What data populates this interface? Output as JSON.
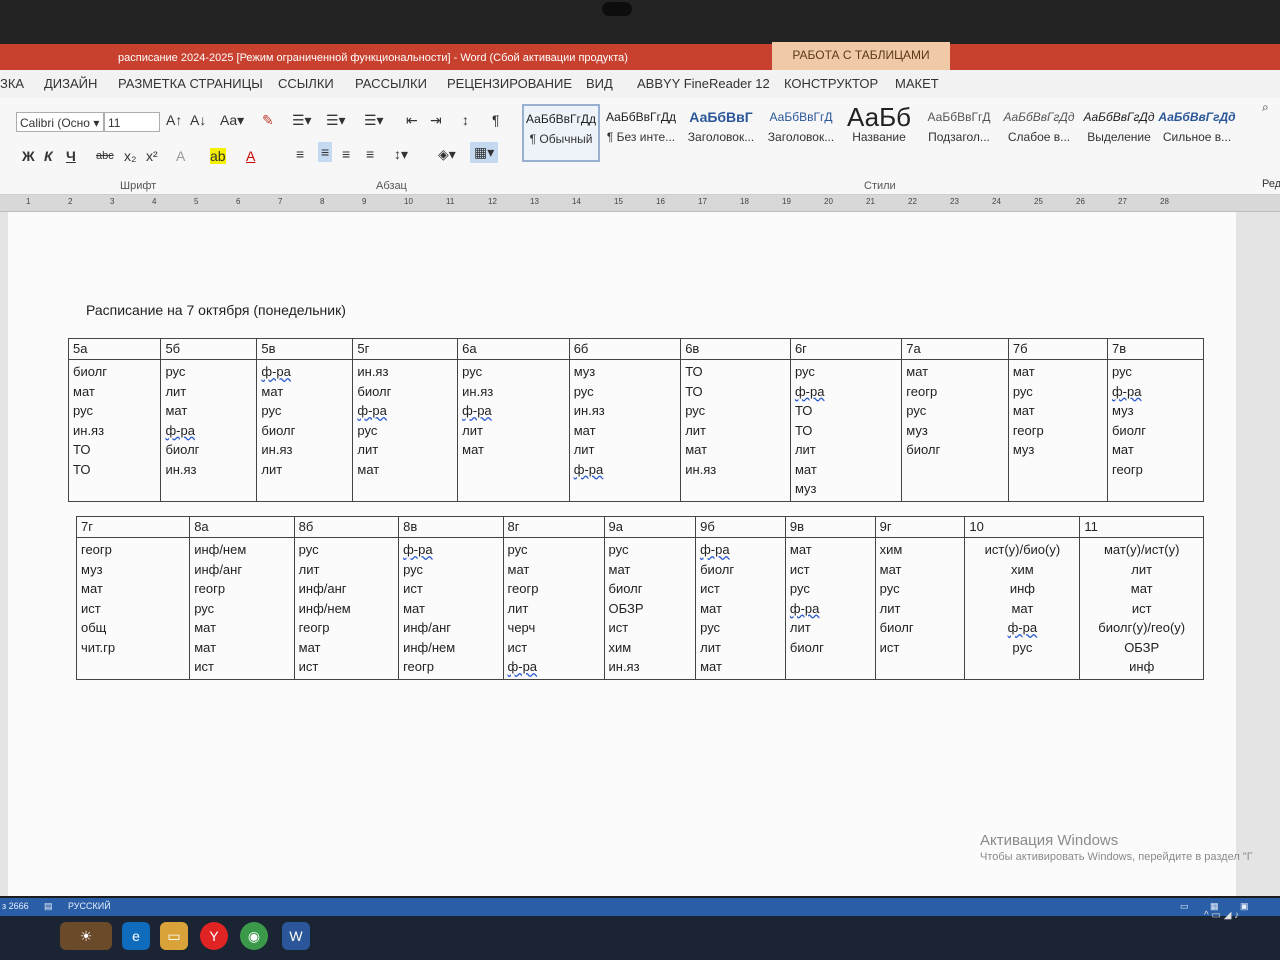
{
  "window": {
    "title": "расписание 2024-2025 [Режим ограниченной функциональности]  -  Word (Сбой активации продукта)",
    "context_tab": "РАБОТА С ТАБЛИЦАМИ"
  },
  "menu": [
    "ЗКА",
    "ДИЗАЙН",
    "РАЗМЕТКА СТРАНИЦЫ",
    "ССЫЛКИ",
    "РАССЫЛКИ",
    "РЕЦЕНЗИРОВАНИЕ",
    "ВИД",
    "ABBYY FineReader 12",
    "КОНСТРУКТОР",
    "МАКЕТ"
  ],
  "ribbon": {
    "font_name": "Calibri (Осно",
    "font_size": "11",
    "font_group": "Шрифт",
    "paragraph_group": "Абзац",
    "styles_group": "Стили",
    "styles": [
      {
        "preview": "АаБбВвГгДд",
        "name": "¶ Обычный"
      },
      {
        "preview": "АаБбВвГгДд",
        "name": "¶ Без инте..."
      },
      {
        "preview": "АаБбВвГ",
        "name": "Заголовок..."
      },
      {
        "preview": "АаБбВвГгД",
        "name": "Заголовок..."
      },
      {
        "preview": "АаБб",
        "name": "Название"
      },
      {
        "preview": "АаБбВвГгД",
        "name": "Подзагол..."
      },
      {
        "preview": "АаБбВвГгДд",
        "name": "Слабое в..."
      },
      {
        "preview": "АаБбВвГгДд",
        "name": "Выделение"
      },
      {
        "preview": "АаБбВвГгДд",
        "name": "Сильное в..."
      }
    ],
    "right_label": "Ред"
  },
  "ruler": [
    "1",
    "2",
    "3",
    "4",
    "5",
    "6",
    "7",
    "8",
    "9",
    "10",
    "11",
    "12",
    "13",
    "14",
    "15",
    "16",
    "17",
    "18",
    "19",
    "20",
    "21",
    "22",
    "23",
    "24",
    "25",
    "26",
    "27",
    "28"
  ],
  "document": {
    "title": "Расписание на 7 октября (понедельник)",
    "table1": {
      "headers": [
        "5а",
        "5б",
        "5в",
        "5г",
        "6а",
        "6б",
        "6в",
        "6г",
        "7а",
        "7б",
        "7в"
      ],
      "columns": [
        [
          "биолг",
          "мат",
          "рус",
          "ин.яз",
          "ТО",
          "ТО"
        ],
        [
          "рус",
          "лит",
          "мат",
          "ф-ра",
          "биолг",
          "ин.яз"
        ],
        [
          "ф-ра",
          "мат",
          "рус",
          "биолг",
          "ин.яз",
          "лит"
        ],
        [
          "ин.яз",
          "биолг",
          "ф-ра",
          "рус",
          "лит",
          "мат"
        ],
        [
          "рус",
          "ин.яз",
          "ф-ра",
          "лит",
          "мат"
        ],
        [
          "муз",
          "рус",
          "ин.яз",
          "мат",
          "лит",
          "ф-ра"
        ],
        [
          "ТО",
          "ТО",
          "рус",
          "лит",
          "мат",
          "ин.яз"
        ],
        [
          "рус",
          "ф-ра",
          "ТО",
          "ТО",
          "лит",
          "мат",
          "муз"
        ],
        [
          "мат",
          "геогр",
          "рус",
          "муз",
          "биолг"
        ],
        [
          "мат",
          "рус",
          "мат",
          "геогр",
          "муз"
        ],
        [
          "рус",
          "ф-ра",
          "муз",
          "биолг",
          "мат",
          "геогр"
        ]
      ]
    },
    "table2": {
      "headers": [
        "7г",
        "8а",
        "8б",
        "8в",
        "8г",
        "9а",
        "9б",
        "9в",
        "9г",
        "10",
        "11"
      ],
      "columns": [
        [
          "геогр",
          "муз",
          "мат",
          "ист",
          "общ",
          "чит.гр"
        ],
        [
          "инф/нем",
          "инф/анг",
          "геогр",
          "рус",
          "мат",
          "мат",
          "ист"
        ],
        [
          "рус",
          "лит",
          "инф/анг",
          "инф/нем",
          "геогр",
          "мат",
          "ист"
        ],
        [
          "ф-ра",
          "рус",
          "ист",
          "мат",
          "инф/анг",
          "инф/нем",
          "геогр"
        ],
        [
          "рус",
          "мат",
          "геогр",
          "лит",
          "черч",
          "ист",
          "ф-ра"
        ],
        [
          "рус",
          "мат",
          "биолг",
          "ОБЗР",
          "ист",
          "хим",
          "ин.яз"
        ],
        [
          "ф-ра",
          "биолг",
          "ист",
          "мат",
          "рус",
          "лит",
          "мат"
        ],
        [
          "мат",
          "ист",
          "рус",
          "ф-ра",
          "лит",
          "биолг"
        ],
        [
          "хим",
          "мат",
          "рус",
          "лит",
          "биолг",
          "ист"
        ],
        [
          "ист(у)/био(у)",
          "хим",
          "инф",
          "мат",
          "ф-ра",
          "рус"
        ],
        [
          "мат(у)/ист(у)",
          "лит",
          "мат",
          "ист",
          "биолг(у)/гео(у)",
          "ОБЗР",
          "инф"
        ]
      ]
    }
  },
  "activation": {
    "line1": "Активация Windows",
    "line2": "Чтобы активировать Windows, перейдите в раздел \"Г"
  },
  "status": {
    "words": "з 2666",
    "language": "РУССКИЙ"
  },
  "colors": {
    "titlebar": "#c8402e",
    "context_tab": "#f0c9a6",
    "statusbar": "#2a5fa8",
    "spell_underline": "#2b5ccf"
  }
}
